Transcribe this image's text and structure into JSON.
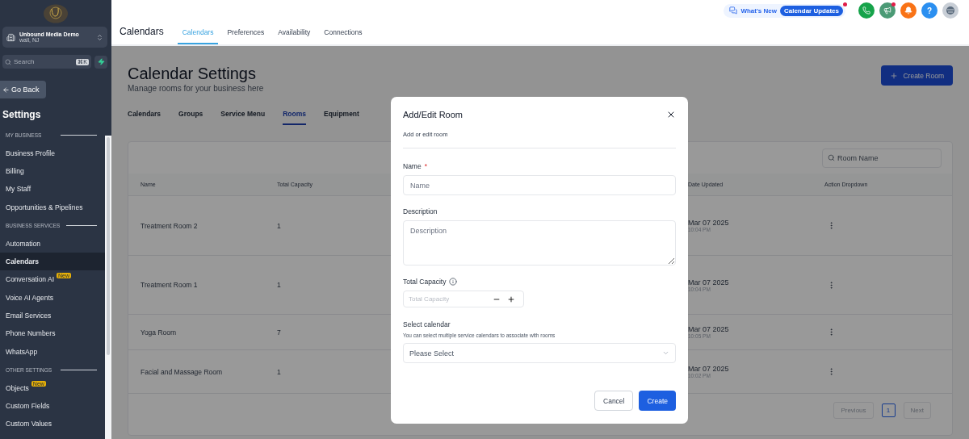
{
  "sidebar": {
    "account": {
      "name": "Unbound Media Demo",
      "location": "wall, NJ"
    },
    "search": {
      "placeholder": "Search",
      "shortcut": "⌘K"
    },
    "go_back": "Go Back",
    "title": "Settings",
    "sections": [
      {
        "heading": "MY BUSINESS",
        "items": [
          {
            "label": "Business Profile",
            "selected": false
          },
          {
            "label": "Billing",
            "selected": false
          },
          {
            "label": "My Staff",
            "selected": false
          },
          {
            "label": "Opportunities & Pipelines",
            "selected": false
          }
        ]
      },
      {
        "heading": "BUSINESS SERVICES",
        "items": [
          {
            "label": "Automation",
            "selected": false
          },
          {
            "label": "Calendars",
            "selected": true
          },
          {
            "label": "Conversation AI",
            "selected": false,
            "badge": "New"
          },
          {
            "label": "Voice AI Agents",
            "selected": false
          },
          {
            "label": "Email Services",
            "selected": false
          },
          {
            "label": "Phone Numbers",
            "selected": false
          },
          {
            "label": "WhatsApp",
            "selected": false
          }
        ]
      },
      {
        "heading": "OTHER SETTINGS",
        "items": [
          {
            "label": "Objects",
            "selected": false,
            "badge": "New"
          },
          {
            "label": "Custom Fields",
            "selected": false
          },
          {
            "label": "Custom Values",
            "selected": false
          }
        ]
      }
    ]
  },
  "topbar": {
    "whats_new": "What's New",
    "updates": "Calendar Updates",
    "help": "?",
    "title": "Calendars",
    "tabs": [
      {
        "label": "Calendars",
        "selected": true
      },
      {
        "label": "Preferences",
        "selected": false
      },
      {
        "label": "Availability",
        "selected": false
      },
      {
        "label": "Connections",
        "selected": false
      }
    ]
  },
  "page": {
    "title": "Calendar Settings",
    "subtitle": "Manage rooms for your business here",
    "create_button": "Create Room",
    "tabs": [
      {
        "label": "Calendars",
        "selected": false
      },
      {
        "label": "Groups",
        "selected": false
      },
      {
        "label": "Service Menu",
        "selected": false
      },
      {
        "label": "Rooms",
        "selected": true
      },
      {
        "label": "Equipment",
        "selected": false
      }
    ],
    "table": {
      "search_placeholder": "Room Name",
      "columns": [
        "Name",
        "Total Capacity",
        "Date Updated",
        "Action Dropdown"
      ],
      "rows": [
        {
          "name": "Treatment Room 2",
          "capacity": "1",
          "date": "Mar 07 2025",
          "time": "10:04 PM"
        },
        {
          "name": "Treatment Room 1",
          "capacity": "1",
          "date": "Mar 07 2025",
          "time": "10:04 PM"
        },
        {
          "name": "Yoga Room",
          "capacity": "7",
          "date": "Mar 07 2025",
          "time": "10:05 PM"
        },
        {
          "name": "Facial and Massage Room",
          "capacity": "1",
          "date": "Mar 07 2025",
          "time": "10:02 PM"
        }
      ],
      "pagination": {
        "previous": "Previous",
        "pages": [
          {
            "label": "1",
            "selected": true
          }
        ],
        "next": "Next"
      }
    }
  },
  "modal": {
    "title": "Add/Edit Room",
    "subtitle": "Add or edit room",
    "name": {
      "label": "Name",
      "required_mark": "*",
      "placeholder": "Name"
    },
    "description": {
      "label": "Description",
      "placeholder": "Description"
    },
    "capacity": {
      "label": "Total Capacity",
      "placeholder": "Total Capacity"
    },
    "calendar": {
      "label": "Select calendar",
      "hint": "You can select multiple service calendars to associate with rooms",
      "placeholder": "Please Select"
    },
    "cancel": "Cancel",
    "create": "Create"
  }
}
